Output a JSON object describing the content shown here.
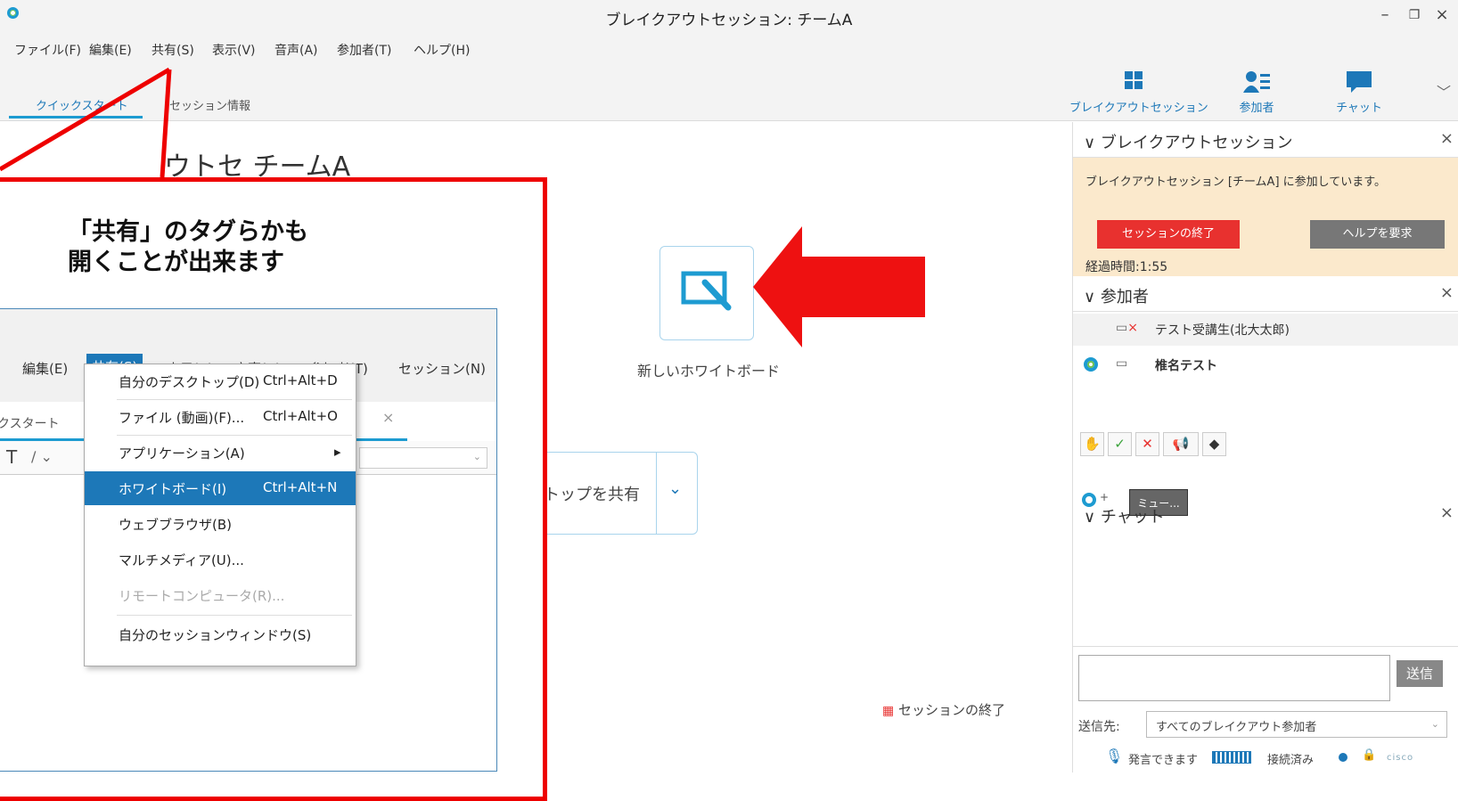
{
  "window": {
    "title": "ブレイクアウトセッション: チームA",
    "minimize": "–",
    "restore": "❐",
    "close": "×"
  },
  "menu": [
    "ファイル(F)",
    "編集(E)",
    "共有(S)",
    "表示(V)",
    "音声(A)",
    "参加者(T)",
    "ヘルプ(H)"
  ],
  "tabs": {
    "quickstart": "クイックスタート",
    "session_info": "セッション情報"
  },
  "toolbar": {
    "breakout": "ブレイクアウトセッション",
    "participants": "参加者",
    "chat": "チャット",
    "collapse": "﹀"
  },
  "main": {
    "heading": "ウトセ チームA",
    "whiteboard_label": "新しいホワイトボード",
    "share_label": "トップを共有",
    "end_session": "セッションの終了"
  },
  "annotation": {
    "line1": "「共有」のタグらかも",
    "line2": "開くことが出来ます"
  },
  "inset": {
    "menu": {
      "edit": "編集(E)",
      "share": "共有(S)",
      "view": "表示(V)",
      "audio": "音声(A)",
      "participants": "参加者(T)",
      "session": "セッション(N)"
    },
    "tab": "クスタート",
    "tool_t": "T",
    "tool_pen": "∕ ⌄",
    "dropdown": [
      {
        "label": "自分のデスクトップ(D)",
        "shortcut": "Ctrl+Alt+D"
      },
      {
        "label": "ファイル (動画)(F)...",
        "shortcut": "Ctrl+Alt+O"
      },
      {
        "label": "アプリケーション(A)",
        "shortcut": "▸"
      },
      {
        "label": "ホワイトボード(I)",
        "shortcut": "Ctrl+Alt+N"
      },
      {
        "label": "ウェブブラウザ(B)",
        "shortcut": ""
      },
      {
        "label": "マルチメディア(U)...",
        "shortcut": ""
      },
      {
        "label": "リモートコンピュータ(R)...",
        "shortcut": ""
      },
      {
        "label": "自分のセッションウィンドウ(S)",
        "shortcut": ""
      }
    ]
  },
  "panel": {
    "breakout": {
      "title": "ブレイクアウトセッション",
      "message": "ブレイクアウトセッション [チームA] に参加しています。",
      "end_button": "セッションの終了",
      "help_button": "ヘルプを要求",
      "elapsed": "経過時間:1:55"
    },
    "participants": {
      "title": "参加者",
      "list": [
        {
          "name": "テスト受講生(北大太郎)"
        },
        {
          "name": "椎名テスト"
        }
      ],
      "mute_button": "ミュー..."
    },
    "chat": {
      "title": "チャット",
      "send_button": "送信",
      "send_to_label": "送信先:",
      "send_to_value": "すべてのブレイクアウト参加者"
    },
    "status": {
      "speak": "発言できます",
      "connected": "接続済み",
      "brand": "cisco"
    }
  },
  "colors": {
    "accent": "#1d9bd1",
    "annotation_red": "#e00000",
    "end_red": "#e8312f"
  }
}
